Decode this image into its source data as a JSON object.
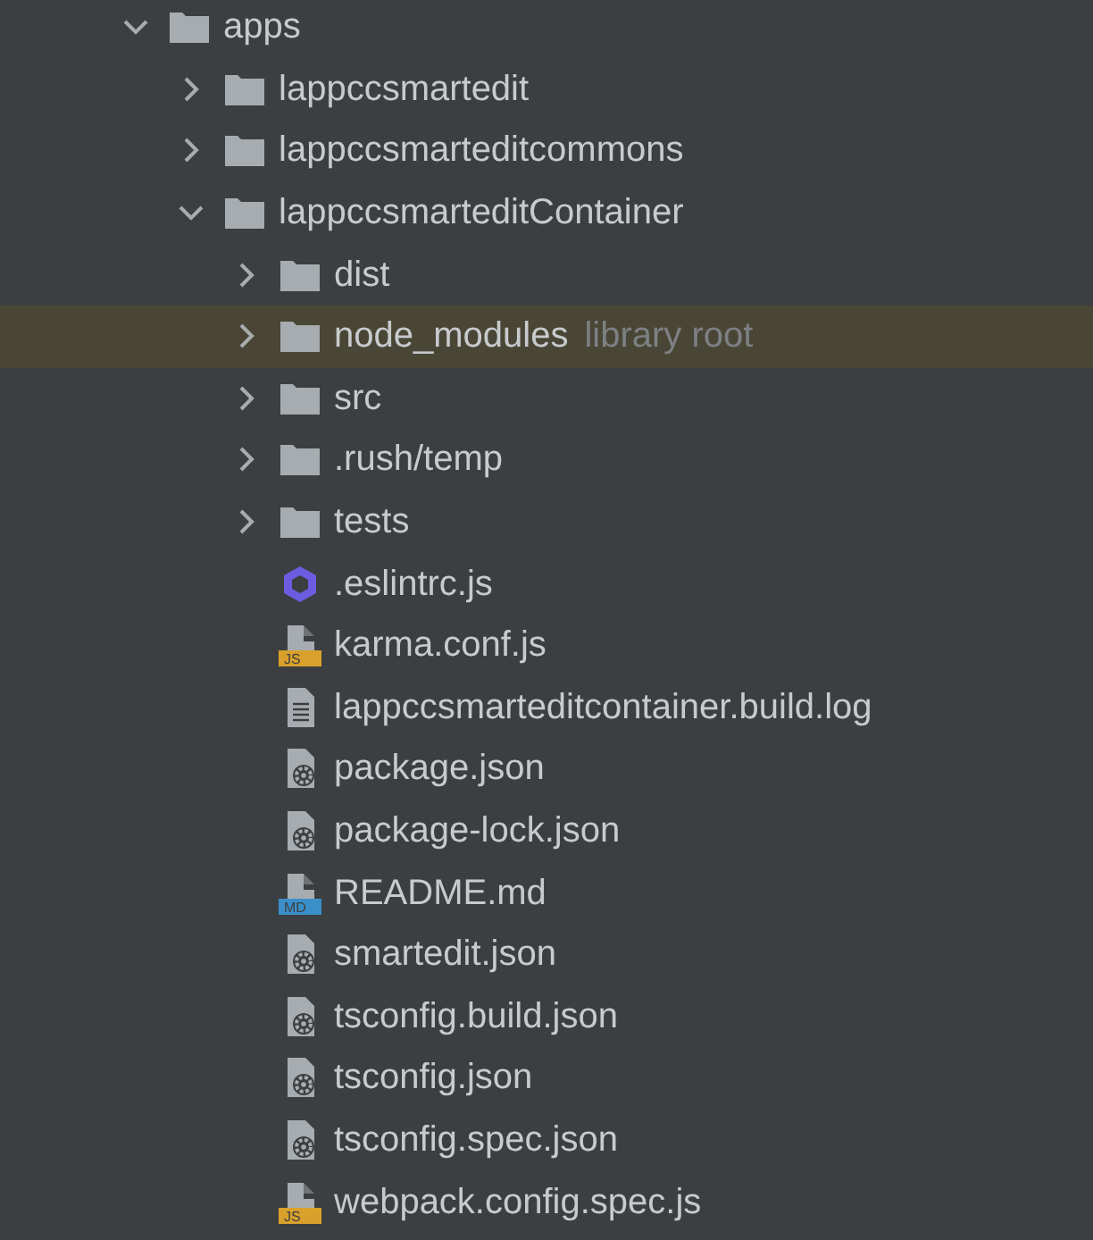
{
  "tree": [
    {
      "name": "apps",
      "kind": "folder",
      "expanded": true,
      "selected": false,
      "children": [
        {
          "name": "lappccsmartedit",
          "kind": "folder",
          "expanded": false,
          "selected": false
        },
        {
          "name": "lappccsmarteditcommons",
          "kind": "folder",
          "expanded": false,
          "selected": false
        },
        {
          "name": "lappccsmarteditContainer",
          "kind": "folder",
          "expanded": true,
          "selected": false,
          "children": [
            {
              "name": "dist",
              "kind": "folder",
              "expanded": false,
              "selected": false
            },
            {
              "name": "node_modules",
              "hint": "library root",
              "kind": "folder",
              "expanded": false,
              "selected": true
            },
            {
              "name": "src",
              "kind": "folder",
              "expanded": false,
              "selected": false
            },
            {
              "name": ".rush/temp",
              "kind": "folder",
              "expanded": false,
              "selected": false
            },
            {
              "name": "tests",
              "kind": "folder",
              "expanded": false,
              "selected": false
            },
            {
              "name": ".eslintrc.js",
              "kind": "eslint",
              "selected": false
            },
            {
              "name": "karma.conf.js",
              "kind": "js",
              "icon_label": "JS",
              "selected": false
            },
            {
              "name": "lappccsmarteditcontainer.build.log",
              "kind": "log",
              "selected": false
            },
            {
              "name": "package.json",
              "kind": "json",
              "selected": false
            },
            {
              "name": "package-lock.json",
              "kind": "json",
              "selected": false
            },
            {
              "name": "README.md",
              "kind": "md",
              "icon_label": "MD",
              "selected": false
            },
            {
              "name": "smartedit.json",
              "kind": "json",
              "selected": false
            },
            {
              "name": "tsconfig.build.json",
              "kind": "json",
              "selected": false
            },
            {
              "name": "tsconfig.json",
              "kind": "json",
              "selected": false
            },
            {
              "name": "tsconfig.spec.json",
              "kind": "json",
              "selected": false
            },
            {
              "name": "webpack.config.spec.js",
              "kind": "js",
              "icon_label": "JS",
              "selected": false
            }
          ]
        }
      ]
    }
  ]
}
